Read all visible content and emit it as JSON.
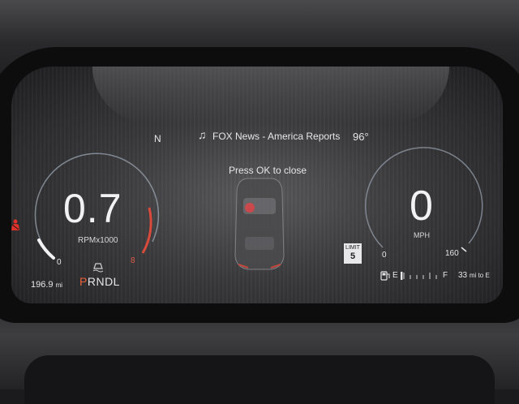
{
  "top_bar": {
    "gear_indicator": "N",
    "media_icon": "music-note-icon",
    "media_text": "FOX News - America Reports",
    "outside_temp": "96°"
  },
  "notification": {
    "text": "Press OK to close"
  },
  "tachometer": {
    "value": "0.7",
    "unit": "RPMx1000",
    "min_label": "0",
    "max_label": "8",
    "redline_color": "#e05b4a"
  },
  "speedometer": {
    "value": "0",
    "unit": "MPH",
    "min_label": "0",
    "max_label": "160"
  },
  "speed_limit": {
    "label": "LIMIT",
    "value": "5"
  },
  "odometer": {
    "value": "196.9",
    "unit": "mi"
  },
  "transmission": {
    "selected": "P",
    "rest": "RNDL",
    "selected_color": "#e8613b"
  },
  "fuel": {
    "empty_label": "E",
    "full_label": "F",
    "range_value": "33",
    "range_unit": "mi to E",
    "level_fraction": 0.05
  },
  "icons": {
    "seatbelt": "seatbelt-warning-icon",
    "traction": "traction-control-icon",
    "fuel": "fuel-pump-icon",
    "car": "vehicle-top-view-icon"
  }
}
